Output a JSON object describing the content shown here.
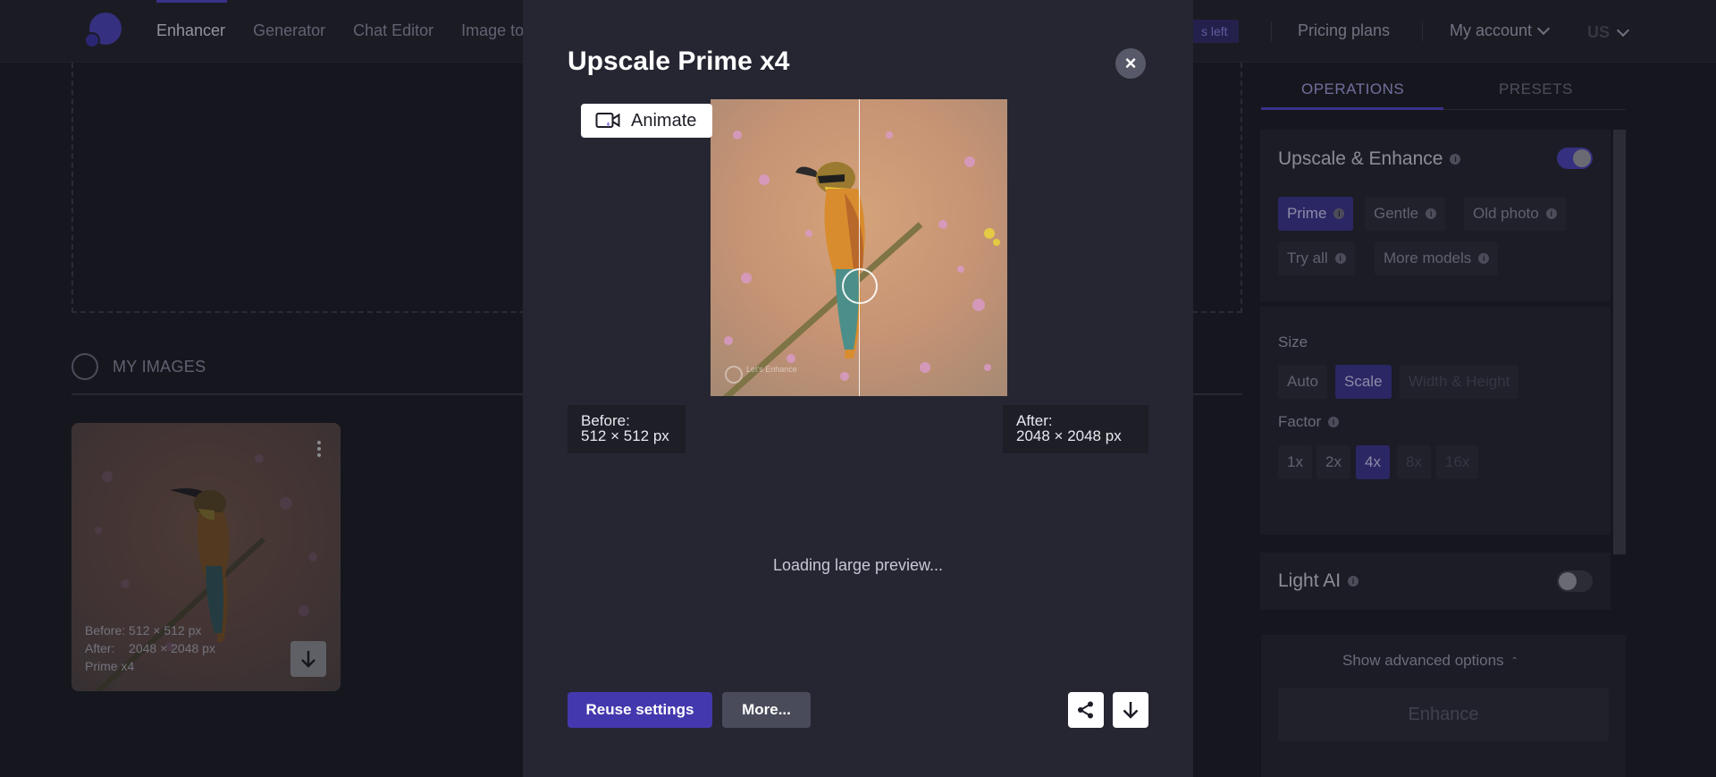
{
  "nav": {
    "items": [
      "Enhancer",
      "Generator",
      "Chat Editor",
      "Image to"
    ],
    "active": "Enhancer",
    "credits_label": "s left",
    "pricing": "Pricing plans",
    "account": "My account",
    "lang": "US"
  },
  "gallery": {
    "section_title": "MY IMAGES",
    "card": {
      "before": "Before: 512 × 512 px",
      "after_label": "After:",
      "after_value": "2048 × 2048 px",
      "model": "Prime x4",
      "watermark": "Let's Enhance"
    }
  },
  "panel": {
    "tabs": [
      "OPERATIONS",
      "PRESETS"
    ],
    "active_tab": "OPERATIONS",
    "upscale": {
      "title": "Upscale & Enhance",
      "enabled": true,
      "models": [
        "Prime",
        "Gentle",
        "Old photo",
        "Try all",
        "More models"
      ],
      "selected_model": "Prime"
    },
    "size": {
      "label": "Size",
      "options": [
        "Auto",
        "Scale",
        "Width & Height"
      ],
      "selected": "Scale"
    },
    "factor": {
      "label": "Factor",
      "options": [
        "1x",
        "2x",
        "4x",
        "8x",
        "16x"
      ],
      "selected": "4x"
    },
    "light_ai": {
      "title": "Light AI",
      "enabled": false
    },
    "advanced": "Show advanced options",
    "enhance_button": "Enhance"
  },
  "modal": {
    "title": "Upscale Prime x4",
    "close": "×",
    "animate": "Animate",
    "before_label": "Before:",
    "before_value": "512 × 512 px",
    "after_label": "After:",
    "after_value": "2048 × 2048 px",
    "loading": "Loading large preview...",
    "reuse": "Reuse settings",
    "more": "More...",
    "watermark": "Let's Enhance",
    "slider_position": 0.5
  },
  "colors": {
    "accent": "#4338ad",
    "background": "#1b1c24",
    "panel": "#23242f"
  }
}
